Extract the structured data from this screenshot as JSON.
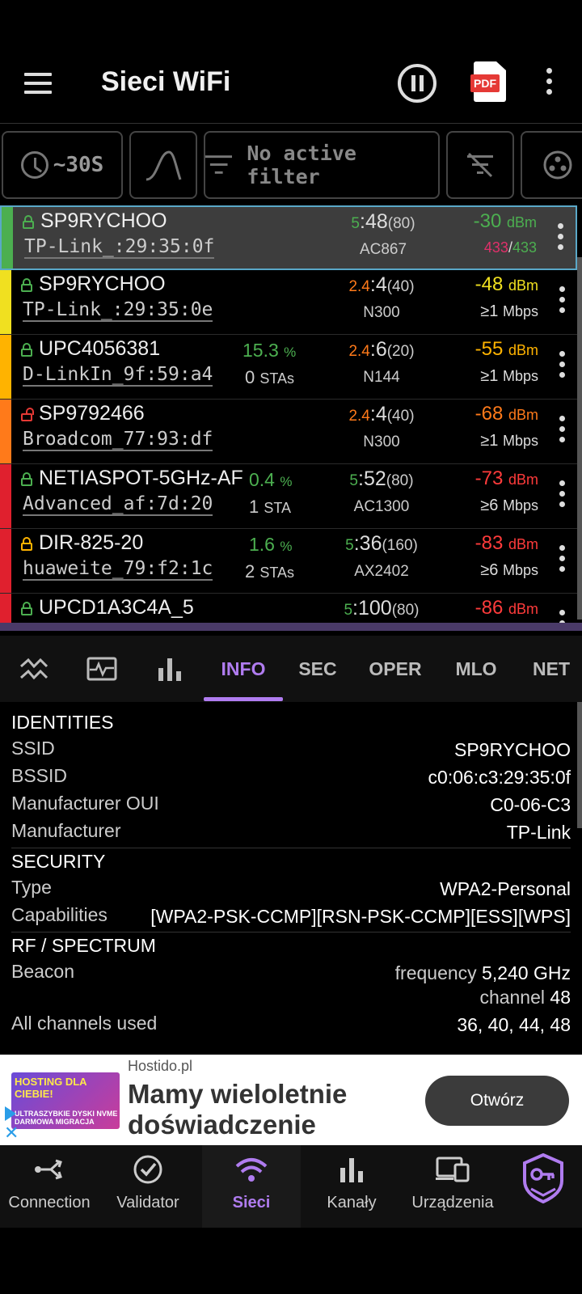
{
  "header": {
    "title": "Sieci WiFi"
  },
  "filters": {
    "interval": "~30S",
    "filter_label": "No active filter"
  },
  "networks": [
    {
      "ssid": "SP9RYCHOO",
      "mac": "TP-Link_:29:35:0f",
      "pct": "",
      "pct_unit": "",
      "stas_n": "",
      "stas_u": "",
      "band": "5",
      "band_color": "#4caf50",
      "channel": ":48",
      "bw": "(80)",
      "std": "AC867",
      "dbm": "-30",
      "dbm_color": "#4caf50",
      "rate_a": "433",
      "rate_b": "433",
      "locked": true,
      "lock_color": "#4caf50",
      "strip": "#4caf50"
    },
    {
      "ssid": "SP9RYCHOO",
      "mac": "TP-Link_:29:35:0e",
      "pct": "",
      "pct_unit": "",
      "stas_n": "",
      "stas_u": "",
      "band": "2.4",
      "band_color": "#ff7a1a",
      "channel": ":4",
      "bw": "(40)",
      "std": "N300",
      "dbm": "-48",
      "dbm_color": "#f0e020",
      "rate": "≥1",
      "rate_unit": "Mbps",
      "locked": true,
      "lock_color": "#4caf50",
      "strip": "#f0e020"
    },
    {
      "ssid": "UPC4056381",
      "mac": "D-LinkIn_9f:59:a4",
      "pct": "15.3",
      "pct_unit": "%",
      "stas_n": "0",
      "stas_u": "STAs",
      "band": "2.4",
      "band_color": "#ff7a1a",
      "channel": ":6",
      "bw": "(20)",
      "std": "N144",
      "dbm": "-55",
      "dbm_color": "#ffb300",
      "rate": "≥1",
      "rate_unit": "Mbps",
      "locked": true,
      "lock_color": "#4caf50",
      "strip": "#ffb300"
    },
    {
      "ssid": "SP9792466",
      "mac": "Broadcom_77:93:df",
      "pct": "",
      "pct_unit": "",
      "stas_n": "",
      "stas_u": "",
      "band": "2.4",
      "band_color": "#ff7a1a",
      "channel": ":4",
      "bw": "(40)",
      "std": "N300",
      "dbm": "-68",
      "dbm_color": "#ff7a1a",
      "rate": "≥1",
      "rate_unit": "Mbps",
      "locked": false,
      "lock_color": "#e53935",
      "strip": "#ff7a1a"
    },
    {
      "ssid": "NETIASPOT-5GHz-AF",
      "mac": "Advanced_af:7d:20",
      "pct": "0.4",
      "pct_unit": "%",
      "stas_n": "1",
      "stas_u": "STA",
      "band": "5",
      "band_color": "#4caf50",
      "channel": ":52",
      "bw": "(80)",
      "std": "AC1300",
      "dbm": "-73",
      "dbm_color": "#ff3b3b",
      "rate": "≥6",
      "rate_unit": "Mbps",
      "locked": true,
      "lock_color": "#4caf50",
      "strip": "#e0202e"
    },
    {
      "ssid": "DIR-825-20",
      "mac": "huaweite_79:f2:1c",
      "pct": "1.6",
      "pct_unit": "%",
      "stas_n": "2",
      "stas_u": "STAs",
      "band": "5",
      "band_color": "#4caf50",
      "channel": ":36",
      "bw": "(160)",
      "std": "AX2402",
      "dbm": "-83",
      "dbm_color": "#ff3b3b",
      "rate": "≥6",
      "rate_unit": "Mbps",
      "locked": true,
      "lock_color": "#ffb300",
      "strip": "#e0202e"
    },
    {
      "ssid": "UPCD1A3C4A_5",
      "mac": "",
      "pct": "",
      "pct_unit": "",
      "stas_n": "",
      "stas_u": "",
      "band": "5",
      "band_color": "#4caf50",
      "channel": ":100",
      "bw": "(80)",
      "std": "",
      "dbm": "-86",
      "dbm_color": "#ff3b3b",
      "rate": "",
      "rate_unit": "",
      "locked": true,
      "lock_color": "#4caf50",
      "strip": "#e0202e"
    }
  ],
  "tabs": {
    "info": "INFO",
    "sec": "SEC",
    "oper": "OPER",
    "mlo": "MLO",
    "net": "NET"
  },
  "details": {
    "identities": "IDENTITIES",
    "ssid_label": "SSID",
    "ssid_value": "SP9RYCHOO",
    "bssid_label": "BSSID",
    "bssid_value": "c0:06:c3:29:35:0f",
    "oui_label": "Manufacturer OUI",
    "oui_value": "C0-06-C3",
    "manu_label": "Manufacturer",
    "manu_value": "TP-Link",
    "security": "SECURITY",
    "type_label": "Type",
    "type_value": "WPA2-Personal",
    "cap_label": "Capabilities",
    "cap_value": "[WPA2-PSK-CCMP][RSN-PSK-CCMP][ESS][WPS]",
    "rf": "RF / SPECTRUM",
    "beacon_label": "Beacon",
    "freq_word": "frequency",
    "freq_value": "5,240 GHz",
    "chan_word": "channel",
    "chan_value": "48",
    "allch_label": "All channels used",
    "allch_value": "36, 40, 44, 48"
  },
  "ad": {
    "source": "Hostido.pl",
    "headline": "Mamy wieloletnie doświadczenie",
    "button": "Otwórz",
    "image_text1": "HOSTING DLA CIEBIE!",
    "image_text2": "ULTRASZYBKIE DYSKI NVME DARMOWA MIGRACJA"
  },
  "bottom_nav": [
    {
      "label": "Connection",
      "icon": "connection-icon"
    },
    {
      "label": "Validator",
      "icon": "check-circle-icon"
    },
    {
      "label": "Sieci",
      "icon": "wifi-icon"
    },
    {
      "label": "Kanały",
      "icon": "bar-chart-icon"
    },
    {
      "label": "Urządzenia",
      "icon": "devices-icon"
    },
    {
      "label": "",
      "icon": "premium-badge-icon"
    }
  ],
  "colors": {
    "accent": "#b07cf0",
    "selected_border": "#5aa8c8"
  }
}
